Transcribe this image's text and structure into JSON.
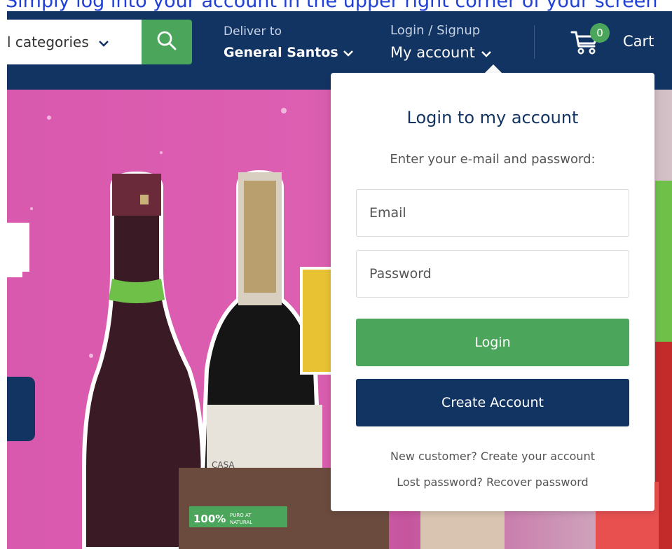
{
  "caption": "Simply log into your account in the upper right corner of your screen",
  "header": {
    "category_select": "l categories",
    "deliver_label": "Deliver to",
    "deliver_value": "General Santos",
    "login_label": "Login / Signup",
    "account_value": "My account",
    "cart_count": "0",
    "cart_label": "Cart"
  },
  "login_dropdown": {
    "title": "Login to my account",
    "subtitle": "Enter your e-mail and password:",
    "email_placeholder": "Email",
    "password_placeholder": "Password",
    "login_button": "Login",
    "create_account_button": "Create Account",
    "new_customer_link": "New customer? Create your account",
    "lost_password_link": "Lost password? Recover password"
  },
  "hero": {
    "product_label": "100% PURO AT NATURAL",
    "bottle_label": "CASA"
  },
  "colors": {
    "navy": "#123463",
    "green": "#4ba65b",
    "pink": "#d859ad",
    "caption_blue": "#1f3fd6"
  }
}
